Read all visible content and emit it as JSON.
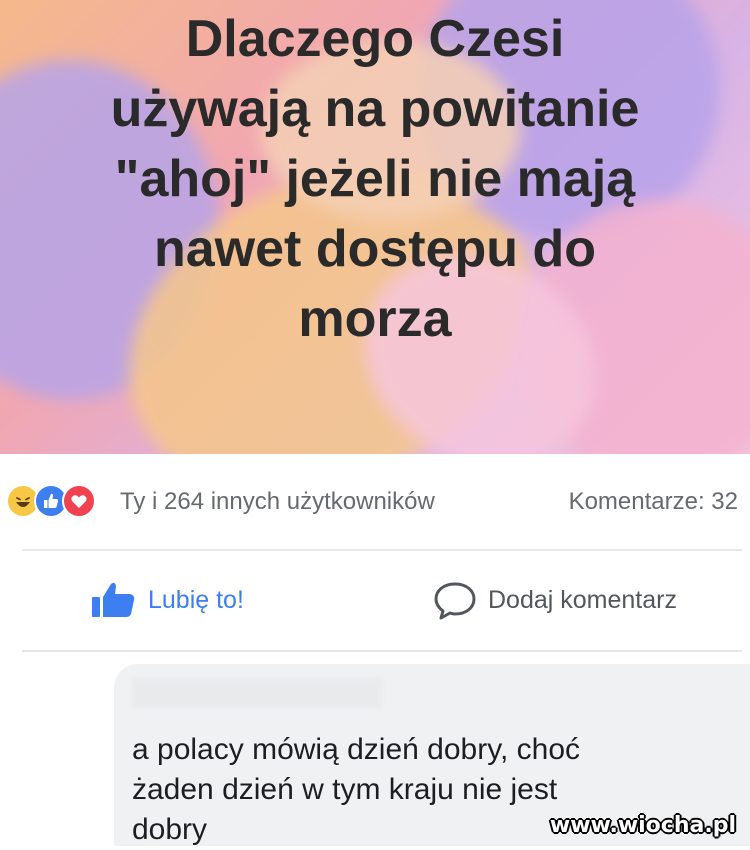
{
  "post": {
    "text_lines": [
      "Dlaczego Czesi",
      "używają na powitanie",
      "\"ahoj\" jeżeli nie mają",
      "nawet dostępu do",
      "morza"
    ],
    "colors": {
      "text": "#2a2a2a"
    }
  },
  "reactions": {
    "icons": [
      "haha-icon",
      "like-icon",
      "love-icon"
    ],
    "summary": "Ty i 264 innych użytkowników",
    "comments_count": "Komentarze: 32"
  },
  "actions": {
    "like_label": "Lubię to!",
    "comment_label": "Dodaj komentarz",
    "accent": "#3d7ef0"
  },
  "comment": {
    "lines": [
      "a polacy mówią dzień dobry, choć",
      "żaden dzień w tym kraju nie jest",
      "dobry"
    ]
  },
  "watermark": "www.wiocha.pl"
}
